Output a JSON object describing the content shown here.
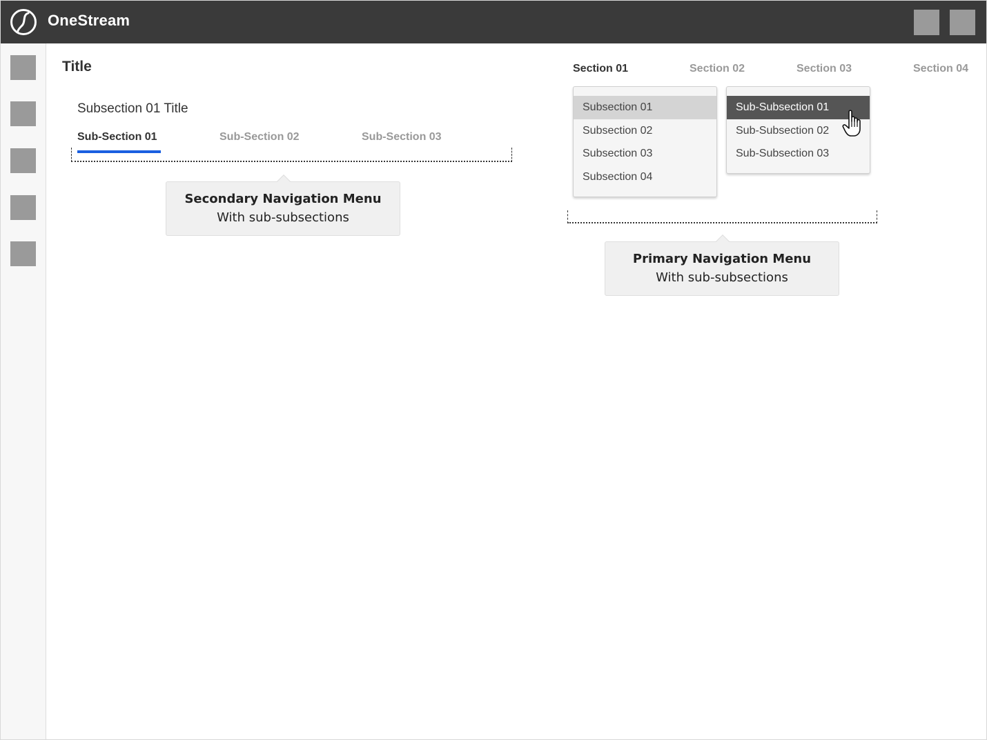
{
  "app": {
    "name": "OneStream"
  },
  "page": {
    "title": "Title"
  },
  "secondary_nav": {
    "subsection_title": "Subsection 01 Title",
    "tabs": [
      {
        "label": "Sub-Section 01",
        "active": true
      },
      {
        "label": "Sub-Section 02",
        "active": false
      },
      {
        "label": "Sub-Section 03",
        "active": false
      }
    ],
    "callout": {
      "title": "Secondary Navigation Menu",
      "subtitle": "With sub-subsections"
    }
  },
  "primary_nav": {
    "tabs": [
      {
        "label": "Section 01",
        "active": true
      },
      {
        "label": "Section 02",
        "active": false
      },
      {
        "label": "Section 03",
        "active": false
      },
      {
        "label": "Section 04",
        "active": false
      }
    ],
    "submenu": {
      "items": [
        "Subsection 01",
        "Subsection 02",
        "Subsection 03",
        "Subsection 04"
      ],
      "highlighted": "Subsection 01"
    },
    "subsubmenu": {
      "items": [
        "Sub-Subsection 01",
        "Sub-Subsection 02",
        "Sub-Subsection 03"
      ],
      "highlighted": "Sub-Subsection 01"
    },
    "callout": {
      "title": "Primary Navigation Menu",
      "subtitle": "With sub-subsections"
    }
  },
  "colors": {
    "topbar": "#3a3a3a",
    "active_underline": "#1a5fe0",
    "placeholder_button": "#9a9a9a",
    "menu_highlight_dark": "#555555",
    "menu_highlight_light": "#d4d4d4"
  },
  "icons": {
    "logo": "onestream-logo-icon",
    "pointer": "hand-pointer-cursor-icon"
  }
}
